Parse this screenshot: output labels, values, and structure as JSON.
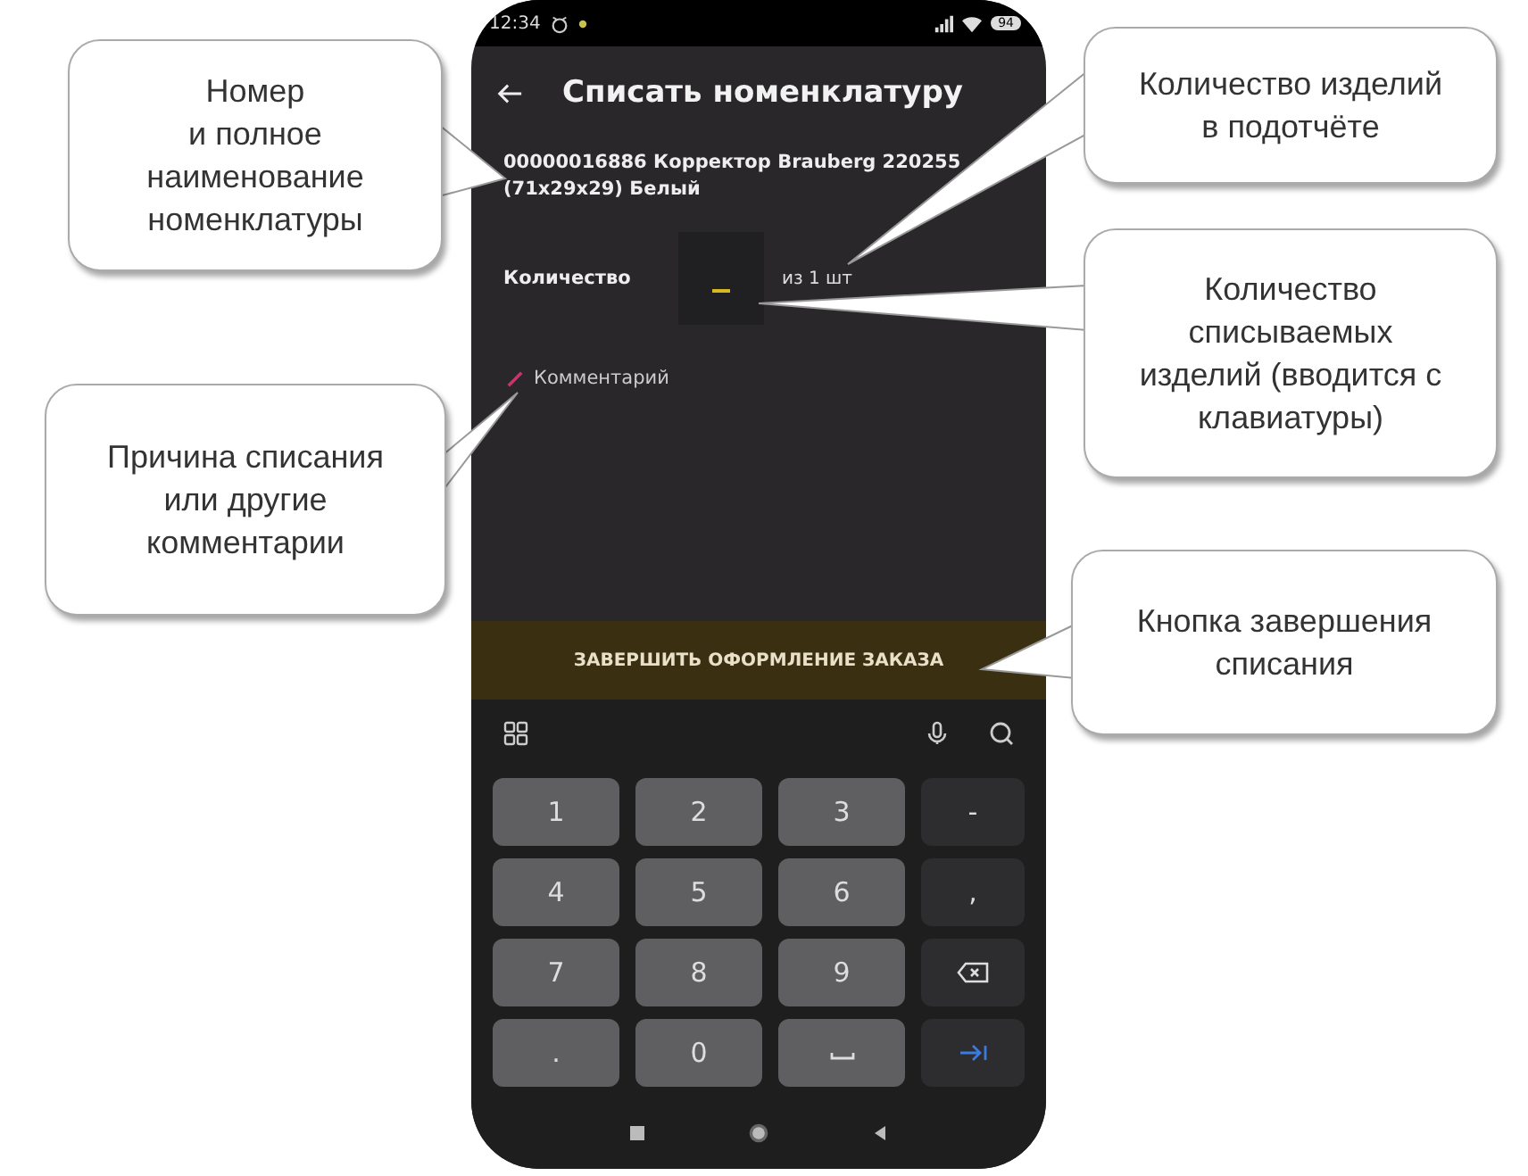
{
  "status_bar": {
    "time": "12:34",
    "battery": "94"
  },
  "header": {
    "title": "Списать номенклатуру"
  },
  "item": {
    "text": "00000016886 Корректор Brauberg 220255 (71x29x29) Белый"
  },
  "quantity": {
    "label": "Количество",
    "focused": true,
    "total": "из 1 шт"
  },
  "comment": {
    "placeholder": "Комментарий"
  },
  "submit_button": {
    "label": "ЗАВЕРШИТЬ ОФОРМЛЕНИЕ ЗАКАЗА"
  },
  "keyboard": {
    "keys": [
      {
        "kind": "digit",
        "label": "1"
      },
      {
        "kind": "digit",
        "label": "2"
      },
      {
        "kind": "digit",
        "label": "3"
      },
      {
        "kind": "symbol",
        "label": "-"
      },
      {
        "kind": "digit",
        "label": "4"
      },
      {
        "kind": "digit",
        "label": "5"
      },
      {
        "kind": "digit",
        "label": "6"
      },
      {
        "kind": "symbol",
        "label": ","
      },
      {
        "kind": "digit",
        "label": "7"
      },
      {
        "kind": "digit",
        "label": "8"
      },
      {
        "kind": "digit",
        "label": "9"
      },
      {
        "kind": "backspace"
      },
      {
        "kind": "digit",
        "label": "."
      },
      {
        "kind": "digit",
        "label": "0"
      },
      {
        "kind": "space"
      },
      {
        "kind": "enter"
      }
    ]
  },
  "callouts": [
    {
      "text": "Номер\nи полное\nнаименование\nноменклатуры"
    },
    {
      "text": "Причина списания\nили другие\nкомментарии"
    },
    {
      "text": "Количество изделий\nв подотчёте"
    },
    {
      "text": "Количество\nсписываемых\nизделий (вводится с\nклавиатуры)"
    },
    {
      "text": "Кнопка завершения\nсписания"
    }
  ]
}
